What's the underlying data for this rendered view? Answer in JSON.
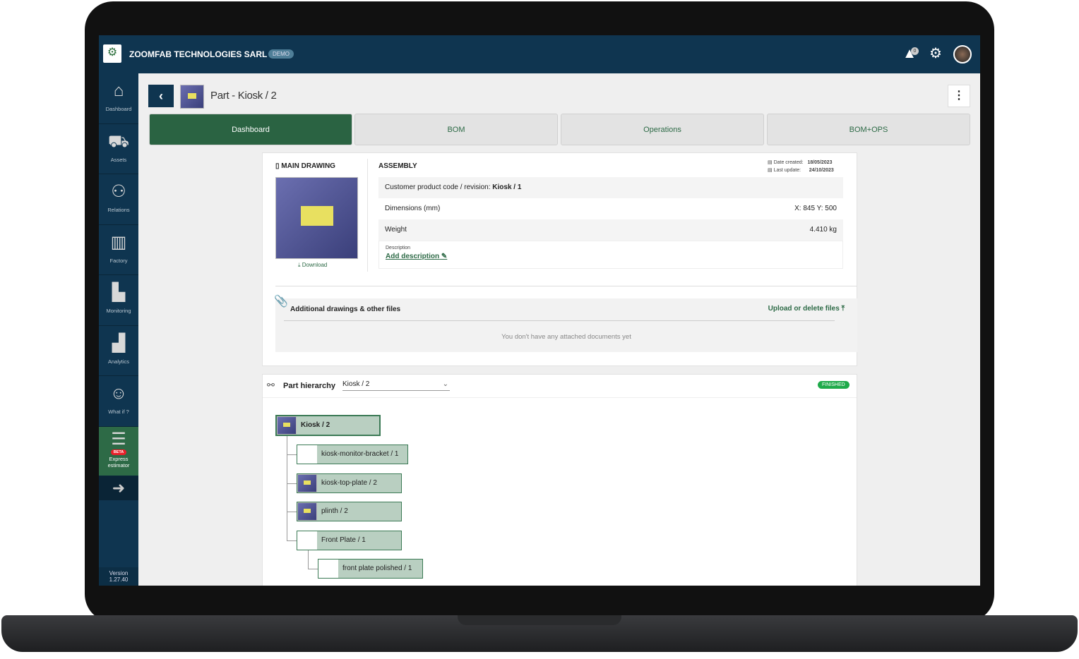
{
  "header": {
    "company": "ZOOMFAB TECHNOLOGIES SARL",
    "badge": "DEMO",
    "notification_count": "0",
    "logo_text": "ZOOMFAB"
  },
  "sidebar": {
    "items": [
      {
        "label": "Dashboard",
        "icon": "home-icon"
      },
      {
        "label": "Assets",
        "icon": "assets-icon"
      },
      {
        "label": "Relations",
        "icon": "relations-icon"
      },
      {
        "label": "Factory",
        "icon": "factory-icon"
      },
      {
        "label": "Monitoring",
        "icon": "monitoring-icon"
      },
      {
        "label": "Analytics",
        "icon": "analytics-icon"
      },
      {
        "label": "What if ?",
        "icon": "thinker-icon"
      },
      {
        "label": "Express estimator",
        "icon": "estimator-icon",
        "badge": "BETA"
      }
    ],
    "version_label": "Version",
    "version": "1.27.40"
  },
  "page": {
    "title": "Part - Kiosk / 2"
  },
  "tabs": [
    {
      "label": "Dashboard",
      "active": true
    },
    {
      "label": "BOM"
    },
    {
      "label": "Operations"
    },
    {
      "label": "BOM+OPS"
    }
  ],
  "drawing": {
    "title": "MAIN DRAWING",
    "download": "Download"
  },
  "assembly": {
    "title": "ASSEMBLY",
    "date_created_label": "Date created:",
    "date_created": "18/05/2023",
    "last_update_label": "Last update:",
    "last_update": "24/10/2023",
    "code_label": "Customer product code / revision: ",
    "code": "Kiosk / 1",
    "dimensions_label": "Dimensions (mm)",
    "dimensions": "X: 845 Y: 500",
    "weight_label": "Weight",
    "weight": "4.410 kg",
    "description_label": "Description",
    "add_description": "Add description"
  },
  "files": {
    "title": "Additional drawings & other files",
    "upload": "Upload or delete files",
    "empty": "You don't have any attached documents yet"
  },
  "hierarchy": {
    "title": "Part hierarchy",
    "selected": "Kiosk / 2",
    "status": "FINISHED",
    "nodes": [
      {
        "label": "Kiosk / 2"
      },
      {
        "label": "kiosk-monitor-bracket / 1"
      },
      {
        "label": "kiosk-top-plate / 2"
      },
      {
        "label": "plinth / 2"
      },
      {
        "label": "Front Plate / 1"
      },
      {
        "label": "front plate polished / 1"
      }
    ]
  },
  "colors": {
    "header": "#0f3550",
    "accent": "#2a6342",
    "status": "#1faa4a"
  }
}
